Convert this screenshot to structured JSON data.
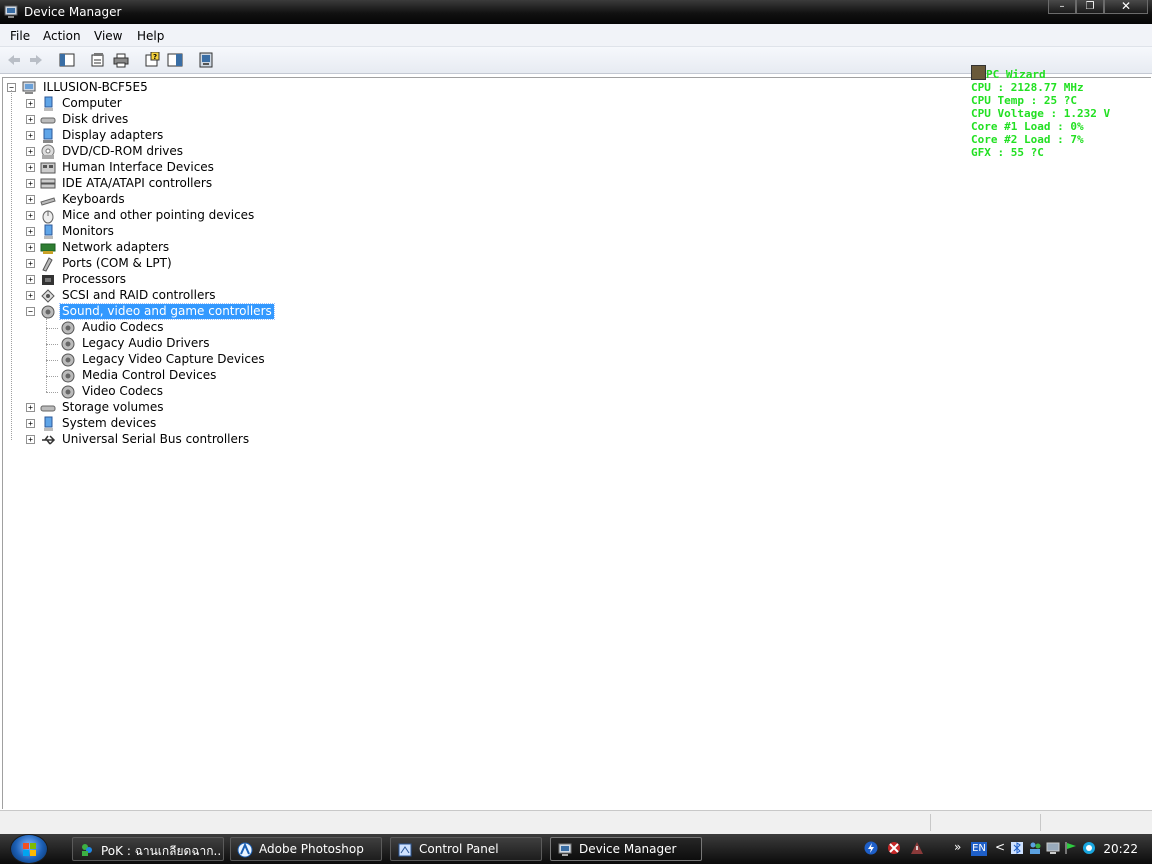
{
  "window": {
    "title": "Device Manager"
  },
  "window_controls": {
    "minimize": "–",
    "restore": "❐",
    "close": "✕"
  },
  "menu": [
    "File",
    "Action",
    "View",
    "Help"
  ],
  "toolbar_icons": [
    "back-arrow-icon",
    "forward-arrow-icon",
    "show-hide-tree-icon",
    "properties-icon",
    "print-icon",
    "help-icon",
    "show-hide-action-pane-icon",
    "scan-hardware-icon"
  ],
  "tree": {
    "root": "ILLUSION-BCF5E5",
    "categories": [
      "Computer",
      "Disk drives",
      "Display adapters",
      "DVD/CD-ROM drives",
      "Human Interface Devices",
      "IDE ATA/ATAPI controllers",
      "Keyboards",
      "Mice and other pointing devices",
      "Monitors",
      "Network adapters",
      "Ports (COM & LPT)",
      "Processors",
      "SCSI and RAID controllers",
      "Sound, video and game controllers",
      "Storage volumes",
      "System devices",
      "Universal Serial Bus controllers"
    ],
    "expanded_children": [
      "Audio Codecs",
      "Legacy Audio Drivers",
      "Legacy Video Capture Devices",
      "Media Control Devices",
      "Video Codecs"
    ],
    "expand_symbol": "+",
    "collapse_symbol": "−"
  },
  "pc_wizard": {
    "title": "PC Wizard",
    "lines": [
      "CPU : 2128.77 MHz",
      "CPU Temp : 25 ?C",
      "CPU Voltage : 1.232 V",
      "Core #1 Load : 0%",
      "Core #2 Load : 7%",
      "GFX : 55 ?C"
    ]
  },
  "taskbar": {
    "tasks": [
      {
        "label": "PoK : ฉานเกลียดฉาก...",
        "icon": "messenger-icon"
      },
      {
        "label": "Adobe Photoshop",
        "icon": "photoshop-icon"
      },
      {
        "label": "Control Panel",
        "icon": "control-panel-icon"
      },
      {
        "label": "Device Manager",
        "icon": "device-manager-icon"
      }
    ],
    "tray": {
      "overflow": "»",
      "language": "EN",
      "chevron": "<"
    },
    "clock": "20:22"
  },
  "colors": {
    "selection": "#3399ff",
    "wizard_text": "#22e022"
  }
}
